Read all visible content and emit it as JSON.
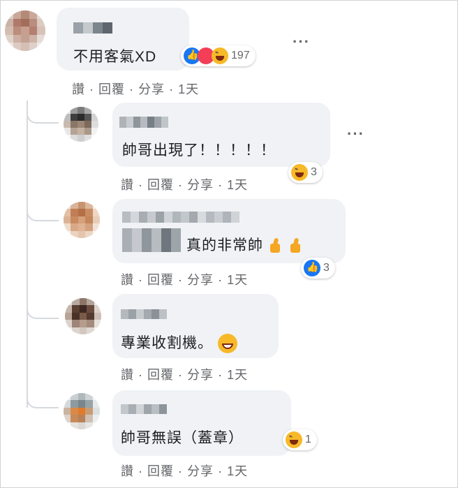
{
  "comments": [
    {
      "text": "不用客氣XD",
      "reactions": [
        "like",
        "love",
        "haha"
      ],
      "reaction_count": "197",
      "actions": {
        "like": "讚",
        "reply": "回覆",
        "share": "分享",
        "time": "1天"
      }
    },
    {
      "text": "帥哥出現了！！！！！",
      "reactions": [
        "haha"
      ],
      "reaction_count": "3",
      "actions": {
        "like": "讚",
        "reply": "回覆",
        "share": "分享",
        "time": "1天"
      }
    },
    {
      "text": "真的非常帥",
      "trailing_emoji": [
        "thumbs-up",
        "thumbs-up"
      ],
      "reactions": [
        "like"
      ],
      "reaction_count": "3",
      "actions": {
        "like": "讚",
        "reply": "回覆",
        "share": "分享",
        "time": "1天"
      }
    },
    {
      "text": "專業收割機。",
      "trailing_emoji": [
        "smile"
      ],
      "actions": {
        "like": "讚",
        "reply": "回覆",
        "share": "分享",
        "time": "1天"
      }
    },
    {
      "text": "帥哥無誤（蓋章）",
      "reactions": [
        "haha"
      ],
      "reaction_count": "1",
      "actions": {
        "like": "讚",
        "reply": "回覆",
        "share": "分享",
        "time": "1天"
      }
    }
  ],
  "separator": "·",
  "more_menu": "···",
  "colors": {
    "bubble": "#f0f2f5",
    "like": "#1877f2",
    "love": "#f33e58",
    "haha": "#f7b928",
    "meta_text": "#65676b"
  }
}
